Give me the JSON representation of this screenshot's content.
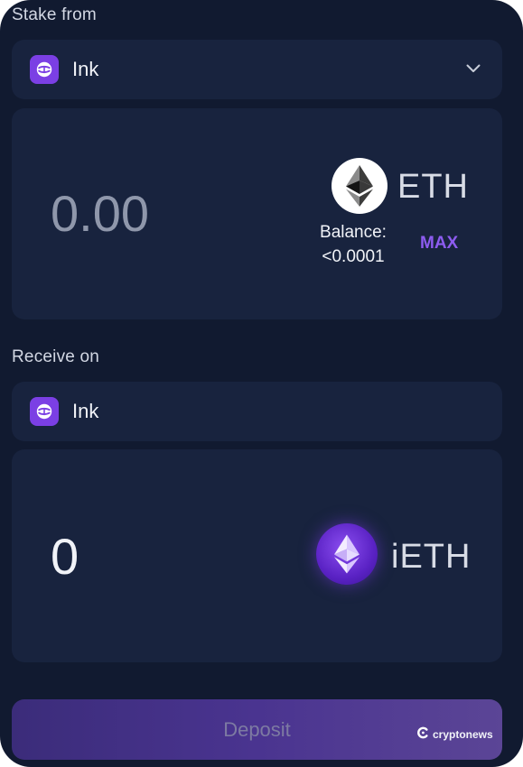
{
  "stake": {
    "section_label": "Stake from",
    "chain_name": "Ink",
    "amount_value": "0.00",
    "token_symbol": "ETH",
    "balance_label": "Balance:",
    "balance_value": "<0.0001",
    "max_label": "MAX"
  },
  "receive": {
    "section_label": "Receive on",
    "chain_name": "Ink",
    "amount_value": "0",
    "token_symbol": "iETH"
  },
  "actions": {
    "deposit_label": "Deposit"
  },
  "watermark": {
    "text": "cryptonews"
  },
  "icons": {
    "chain": "ink-logo-icon",
    "dropdown": "chevron-down-icon",
    "stake_token": "eth-logo-icon",
    "receive_token": "ieth-logo-icon",
    "watermark": "cryptonews-logo-icon"
  },
  "colors": {
    "background": "#111a30",
    "panel": "#18233e",
    "accent": "#8d5cf0",
    "chain_brand": "#7b3fe4",
    "deposit_gradient_start": "#3b2c7a",
    "deposit_gradient_end": "#5b4596"
  }
}
